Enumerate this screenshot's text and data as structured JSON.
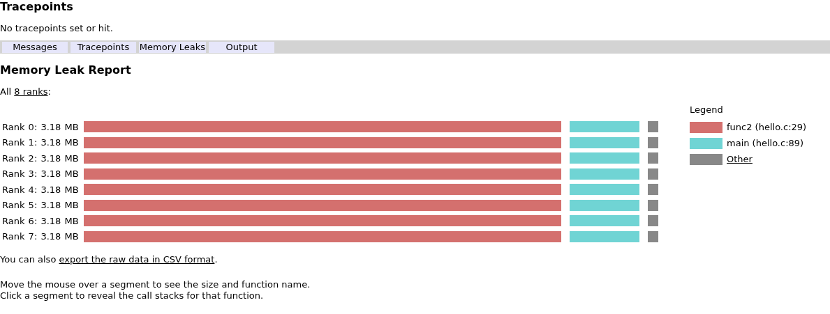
{
  "tracepoints": {
    "title": "Tracepoints",
    "message": "No tracepoints set or hit."
  },
  "tabs": [
    {
      "label": "Messages"
    },
    {
      "label": "Tracepoints"
    },
    {
      "label": "Memory Leaks"
    },
    {
      "label": "Output"
    }
  ],
  "report": {
    "title": "Memory Leak Report",
    "summary": {
      "before": "All ",
      "link": "8 ranks",
      "after": ":"
    },
    "rows": [
      {
        "label": "Rank 0: 3.18 MB"
      },
      {
        "label": "Rank 1: 3.18 MB"
      },
      {
        "label": "Rank 2: 3.18 MB"
      },
      {
        "label": "Rank 3: 3.18 MB"
      },
      {
        "label": "Rank 4: 3.18 MB"
      },
      {
        "label": "Rank 5: 3.18 MB"
      },
      {
        "label": "Rank 6: 3.18 MB"
      },
      {
        "label": "Rank 7: 3.18 MB"
      }
    ],
    "legend": {
      "title": "Legend",
      "items": [
        {
          "label": "func2 (hello.c:29)",
          "color": "#d4706e",
          "kind": "text"
        },
        {
          "label": "main (hello.c:89)",
          "color": "#70d4d4",
          "kind": "text"
        },
        {
          "label": "Other",
          "color": "#888888",
          "kind": "link"
        }
      ]
    },
    "export": {
      "before": "You can also ",
      "link": "export the raw data in CSV format",
      "after": "."
    },
    "notes": [
      "Move the mouse over a segment to see the size and function name.",
      "Click a segment to reveal the call stacks for that function."
    ]
  }
}
